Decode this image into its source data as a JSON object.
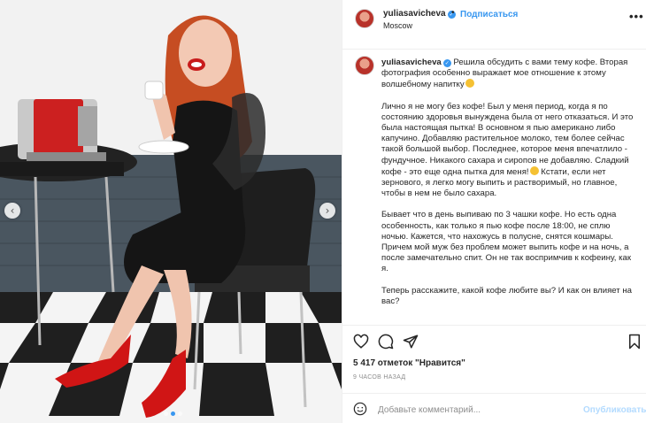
{
  "post": {
    "username": "yuliasavicheva",
    "follow_label": "Подписаться",
    "separator": "•",
    "location": "Moscow",
    "more_icon_text": "•••"
  },
  "caption": {
    "username": "yuliasavicheva",
    "paragraphs": [
      "Решила обсудить с вами тему кофе. Вторая фотография особенно выражает мое отношение к этому волшебному напитку",
      "Лично я не могу без кофе! Был у меня период, когда я по состоянию здоровья вынуждена была от него отказаться. И это была настоящая пытка! В основном я пью американо либо капучино. Добавляю растительное молоко, тем более сейчас такой большой выбор. Последнее, которое меня впечатлило - фундучное. Никакого сахара и сиропов не добавляю. Сладкий кофе - это еще одна пытка для меня!",
      "Кстати, если нет зернового, я легко могу выпить и растворимый, но главное, чтобы в нем не было сахара.",
      "Бывает что в день выпиваю по 3 чашки кофе. Но есть одна особенность, как только я пью кофе после 18:00, не сплю ночью. Кажется, что нахожусь в полусне, снятся кошмары. Причем мой муж без проблем может выпить кофе и на ночь, а после замечательно спит. Он не так воспримчив к кофеину, как я.",
      "Теперь расскажите, какой кофе любите вы? И как он влияет на вас?"
    ]
  },
  "stats": {
    "likes": "5 417 отметок \"Нравится\"",
    "time_ago": "9 ЧАСОВ НАЗАД"
  },
  "comment": {
    "placeholder": "Добавьте комментарий...",
    "publish_label": "Опубликовать"
  },
  "carousel": {
    "prev_arrow": "‹",
    "next_arrow": "›",
    "slide_count": 3,
    "active_slide": 1
  },
  "icons": {
    "header": [
      "avatar",
      "verified-badge-icon",
      "more-options-icon"
    ],
    "actions": [
      "heart-icon",
      "comment-icon",
      "share-icon",
      "bookmark-icon"
    ],
    "comment": [
      "smiley-icon"
    ]
  },
  "colors": {
    "accent": "#3897f0",
    "publish_disabled": "#b3dbff",
    "muted": "#8e8e8e"
  }
}
